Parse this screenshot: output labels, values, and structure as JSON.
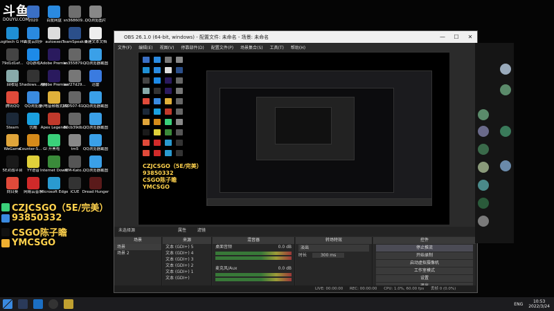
{
  "watermark": {
    "brand": "斗鱼",
    "url": "DOUYU.COM"
  },
  "desktop_icons": [
    {
      "label": "2020",
      "color": "#3a6fc4"
    },
    {
      "label": "百度网盘",
      "color": "#2a8ae0"
    },
    {
      "label": "sn368609...",
      "color": "#6f6f6f"
    },
    {
      "label": "QQ浏览图片",
      "color": "#888"
    },
    {
      "label": "Logitech G HUB",
      "color": "#1f8fd4"
    },
    {
      "label": "百度云同步",
      "color": "#2a8ae0"
    },
    {
      "label": "autoexec",
      "color": "#ddd"
    },
    {
      "label": "TeamSpeak 3",
      "color": "#2b4f8a"
    },
    {
      "label": "新建文本文档",
      "color": "#eee"
    },
    {
      "label": "79d1d1ef...",
      "color": "#444"
    },
    {
      "label": "QQ游戏",
      "color": "#1d8ae8"
    },
    {
      "label": "Adobe Premie...",
      "color": "#2a1a5e"
    },
    {
      "label": "sn355879...",
      "color": "#666"
    },
    {
      "label": "QQ浏览器截图",
      "color": "#3aa0e8"
    },
    {
      "label": "回收站",
      "color": "#8aa"
    },
    {
      "label": "Shadows... 游侠版",
      "color": "#333"
    },
    {
      "label": "Adobe Premiere F...",
      "color": "#2a1a5e"
    },
    {
      "label": "aaf27d29...",
      "color": "#777"
    },
    {
      "label": "迅雷",
      "color": "#3a7be0"
    },
    {
      "label": "腾讯QQ",
      "color": "#e04a3a"
    },
    {
      "label": "QQ浏览器",
      "color": "#3a8be0"
    },
    {
      "label": "闪电音频格式转换器",
      "color": "#e0b03a"
    },
    {
      "label": "150507-61...",
      "color": "#666"
    },
    {
      "label": "QQ浏览器截图",
      "color": "#3aa0e8"
    },
    {
      "label": "Steam",
      "color": "#1b2838"
    },
    {
      "label": "优酷",
      "color": "#1aa0e0"
    },
    {
      "label": "Apex Legends",
      "color": "#c0392b"
    },
    {
      "label": "80cb39db...",
      "color": "#666"
    },
    {
      "label": "QQ浏览器截图",
      "color": "#3aa0e8"
    },
    {
      "label": "WeGame",
      "color": "#e0a53a"
    },
    {
      "label": "Counter-S... Global Off...",
      "color": "#d48a1a"
    },
    {
      "label": "开黑啦",
      "color": "#3ad07a"
    },
    {
      "label": "tm5",
      "color": "#888"
    },
    {
      "label": "QQ浏览器截图",
      "color": "#3aa0e8"
    },
    {
      "label": "5E对战平台",
      "color": "#1a1a1a"
    },
    {
      "label": "YY语音",
      "color": "#e0d03a"
    },
    {
      "label": "Internet Downlo...",
      "color": "#3a8a3a"
    },
    {
      "label": "IEM-Kato...",
      "color": "#555"
    },
    {
      "label": "QQ浏览器截图",
      "color": "#3aa0e8"
    },
    {
      "label": "向日葵",
      "color": "#e04a3a"
    },
    {
      "label": "网易云音乐",
      "color": "#d02a2a"
    },
    {
      "label": "Microsoft Edge",
      "color": "#2a9ad0"
    },
    {
      "label": "iCUE",
      "color": "#333"
    },
    {
      "label": "Dread Hunger",
      "color": "#5a1a1a"
    }
  ],
  "overlay": {
    "lines": [
      {
        "text": "CZJCSGO（5E/完美）",
        "icon": "wechat-icon",
        "icon_color": "#3ad07a"
      },
      {
        "text": "93850332",
        "icon": "qq-icon",
        "icon_color": "#3a8ae0"
      },
      {
        "text": "CSGO陈子瞻",
        "icon": "tiktok-icon",
        "icon_color": "#111"
      },
      {
        "text": "YMCSGO",
        "icon": "kuaishou-icon",
        "icon_color": "#f0b030"
      }
    ]
  },
  "obs": {
    "title": "OBS 26.1.0 (64-bit, windows) - 配置文件: 未命名 - 场景: 未命名",
    "menu": [
      "文件(F)",
      "编辑(E)",
      "视图(V)",
      "停靠部件(D)",
      "配置文件(P)",
      "场景集合(S)",
      "工具(T)",
      "帮助(H)"
    ],
    "window_buttons": [
      "—",
      "☐",
      "✕"
    ],
    "tabs": [
      "未选择源",
      "属性",
      "滤镜"
    ],
    "scenes": {
      "header": "场景",
      "items": [
        "场景",
        "场景 2"
      ],
      "selected": 0
    },
    "sources": {
      "header": "来源",
      "items": [
        "文本 (GDI+) 5",
        "文本 (GDI+) 4",
        "文本 (GDI+) 3",
        "文本 (GDI+) 2",
        "文本 (GDI+) 1",
        "文本 (GDI+)"
      ]
    },
    "mixer": {
      "header": "混音器",
      "channels": [
        "桌面音频",
        "麦克风/Aux"
      ],
      "levels": [
        "0.0 dB",
        "0.0 dB"
      ]
    },
    "transitions": {
      "header": "转场特效",
      "type": "淡出",
      "duration_label": "时长",
      "duration": "300 ms"
    },
    "controls": {
      "header": "控件",
      "buttons": [
        "停止推流",
        "开始录制",
        "启动虚拟摄像机",
        "工作室模式",
        "设置",
        "退出"
      ]
    },
    "status": {
      "dropped": "丢帧 0 (0.0%)",
      "live": "LIVE: 00:00:00",
      "rec": "REC: 00:00:00",
      "cpu": "CPU: 1.0%, 60.00 fps"
    }
  },
  "taskbar": {
    "lang": "ENG",
    "time": "10:53",
    "date": "2022/3/24"
  }
}
